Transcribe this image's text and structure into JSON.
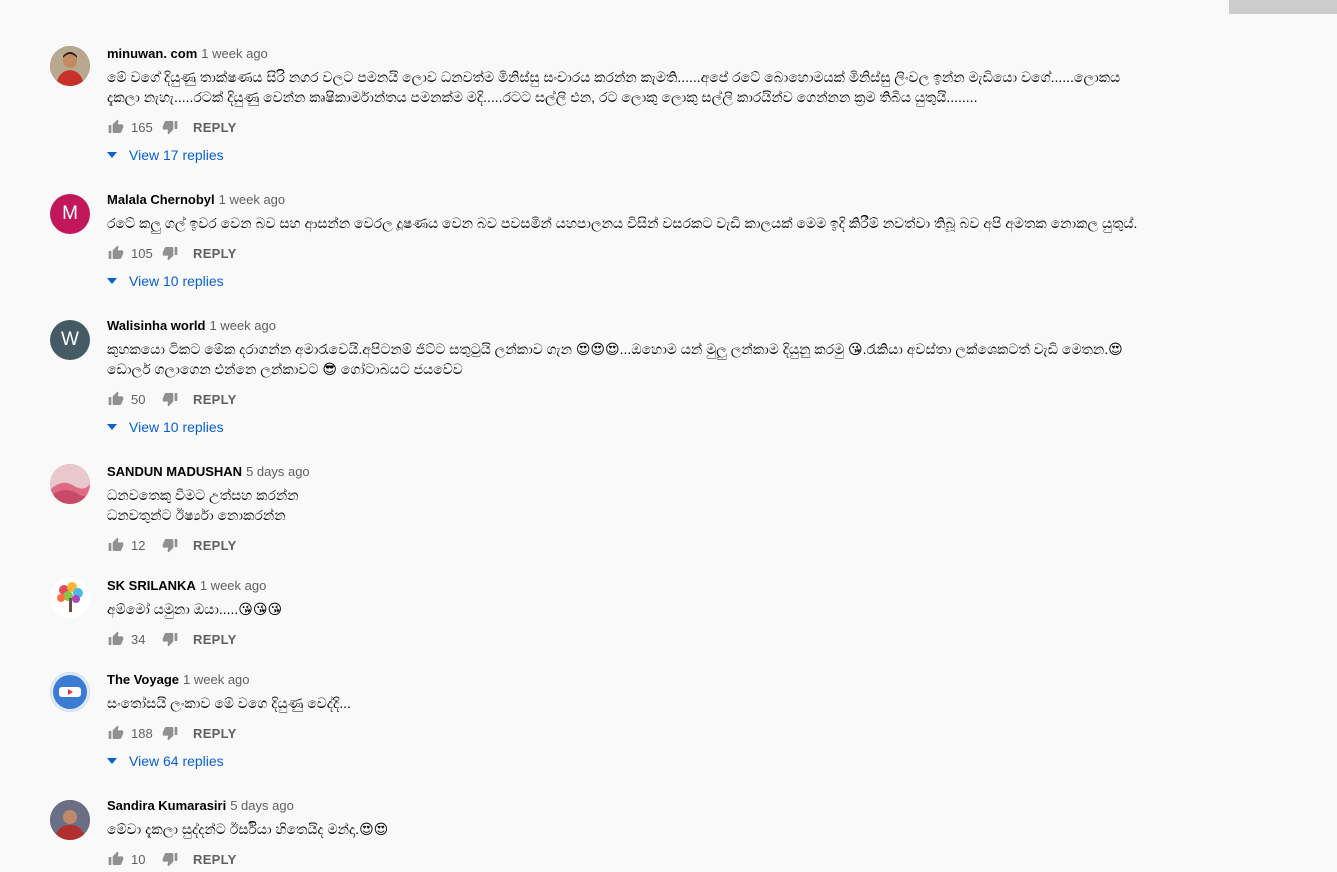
{
  "ui": {
    "reply_label": "REPLY"
  },
  "colors": {
    "link_blue": "#065fd4",
    "meta_gray": "#606060",
    "text": "#030303",
    "background": "#f9f9f9"
  },
  "comments": [
    {
      "author": "minuwan. com",
      "time": "1 week ago",
      "avatar": {
        "type": "photo",
        "color": "#8a6a52"
      },
      "text": "මේ වගේ දියුණු තාක්ෂණය සිරි නගර වලට පමනයි ලොව ධනවත්ම මිනිස්සු සංචාරය කරන්න කැමති......අපේ රටේ බොහොමයක් මිනිස්සු ලිංවල ඉන්න මැඩියො වගේ......ලොකය\nදැකලා නැහැ.....රටක් දියුණු වෙන්න කෘෂිකාර්මාන්තය පමනක්ම මදි.....රටට සල්ලි එන, රට ලොකු ලොකු සල්ලි කාරයින්ව ගෙන්නන ක්‍රම තිබිය යුතුයි........",
      "likes": "165",
      "replies": "View 17 replies"
    },
    {
      "author": "Malala Chernobyl",
      "time": "1 week ago",
      "avatar": {
        "type": "letter",
        "letter": "M",
        "color": "#c2185b"
      },
      "text": "රටේ කලු ගල් ඉවර වෙන බව සහ ආසන්න වෙරල දූෂණය වෙන බව පවසමින් යහපාලනය විසින් වසරකට වැඩි කාලයක් මෙම ඉදි කිරීම් නවත්වා තිබූ බව අපි අමතක නොකල යුතුය්.",
      "likes": "105",
      "replies": "View 10 replies"
    },
    {
      "author": "Walisinha world",
      "time": "1 week ago",
      "avatar": {
        "type": "letter",
        "letter": "W",
        "color": "#455a64"
      },
      "text": "කුහකයො ටිකට මේක දරාගන්න අමාරැවෙයි.අපිටනම් ජිට්ට සතුටුයි ලන්කාව ගැන 😍😍😍...ඔහොම යන් මුලු ලන්කාම දියුනු කරමු 😘.රැකියා අවස්තා ලක්ශෙකටත් වැඩි මෙතන.😍\nඩොලර් ගලාගෙන එන්නෙ ලන්කාවට 😎 ගෝටාබයට ජයවේව",
      "likes": "50",
      "replies": "View 10 replies"
    },
    {
      "author": "SANDUN MADUSHAN",
      "time": "5 days ago",
      "avatar": {
        "type": "photo",
        "color": "#d48a9a"
      },
      "text": "ධනවතෙකු වීමට උත්සහ කරන්න\nධනවතුන්ට ඊර්ෂ්‍යා නොකරන්න",
      "likes": "12",
      "replies": ""
    },
    {
      "author": "SK SRILANKA",
      "time": "1 week ago",
      "avatar": {
        "type": "tree",
        "color": "#ffffff"
      },
      "text": "අම්මෝ යමුනා ඔයා.....😘😘😘",
      "likes": "34",
      "replies": ""
    },
    {
      "author": "The Voyage",
      "time": "1 week ago",
      "avatar": {
        "type": "youtube",
        "color": "#3b7bd4"
      },
      "text": "සංතෝසයි ලංකාව මේ වගෙ දියුණු වෙද්දි...",
      "likes": "188",
      "replies": "View 64 replies"
    },
    {
      "author": "Sandira Kumarasiri",
      "time": "5 days ago",
      "avatar": {
        "type": "photo",
        "color": "#8b3a3a"
      },
      "text": "මේවා දැකලා සුද්දන්ට ඊර්සියා හිතෙයිද මන්දා.😍😍",
      "likes": "10",
      "replies": ""
    }
  ]
}
